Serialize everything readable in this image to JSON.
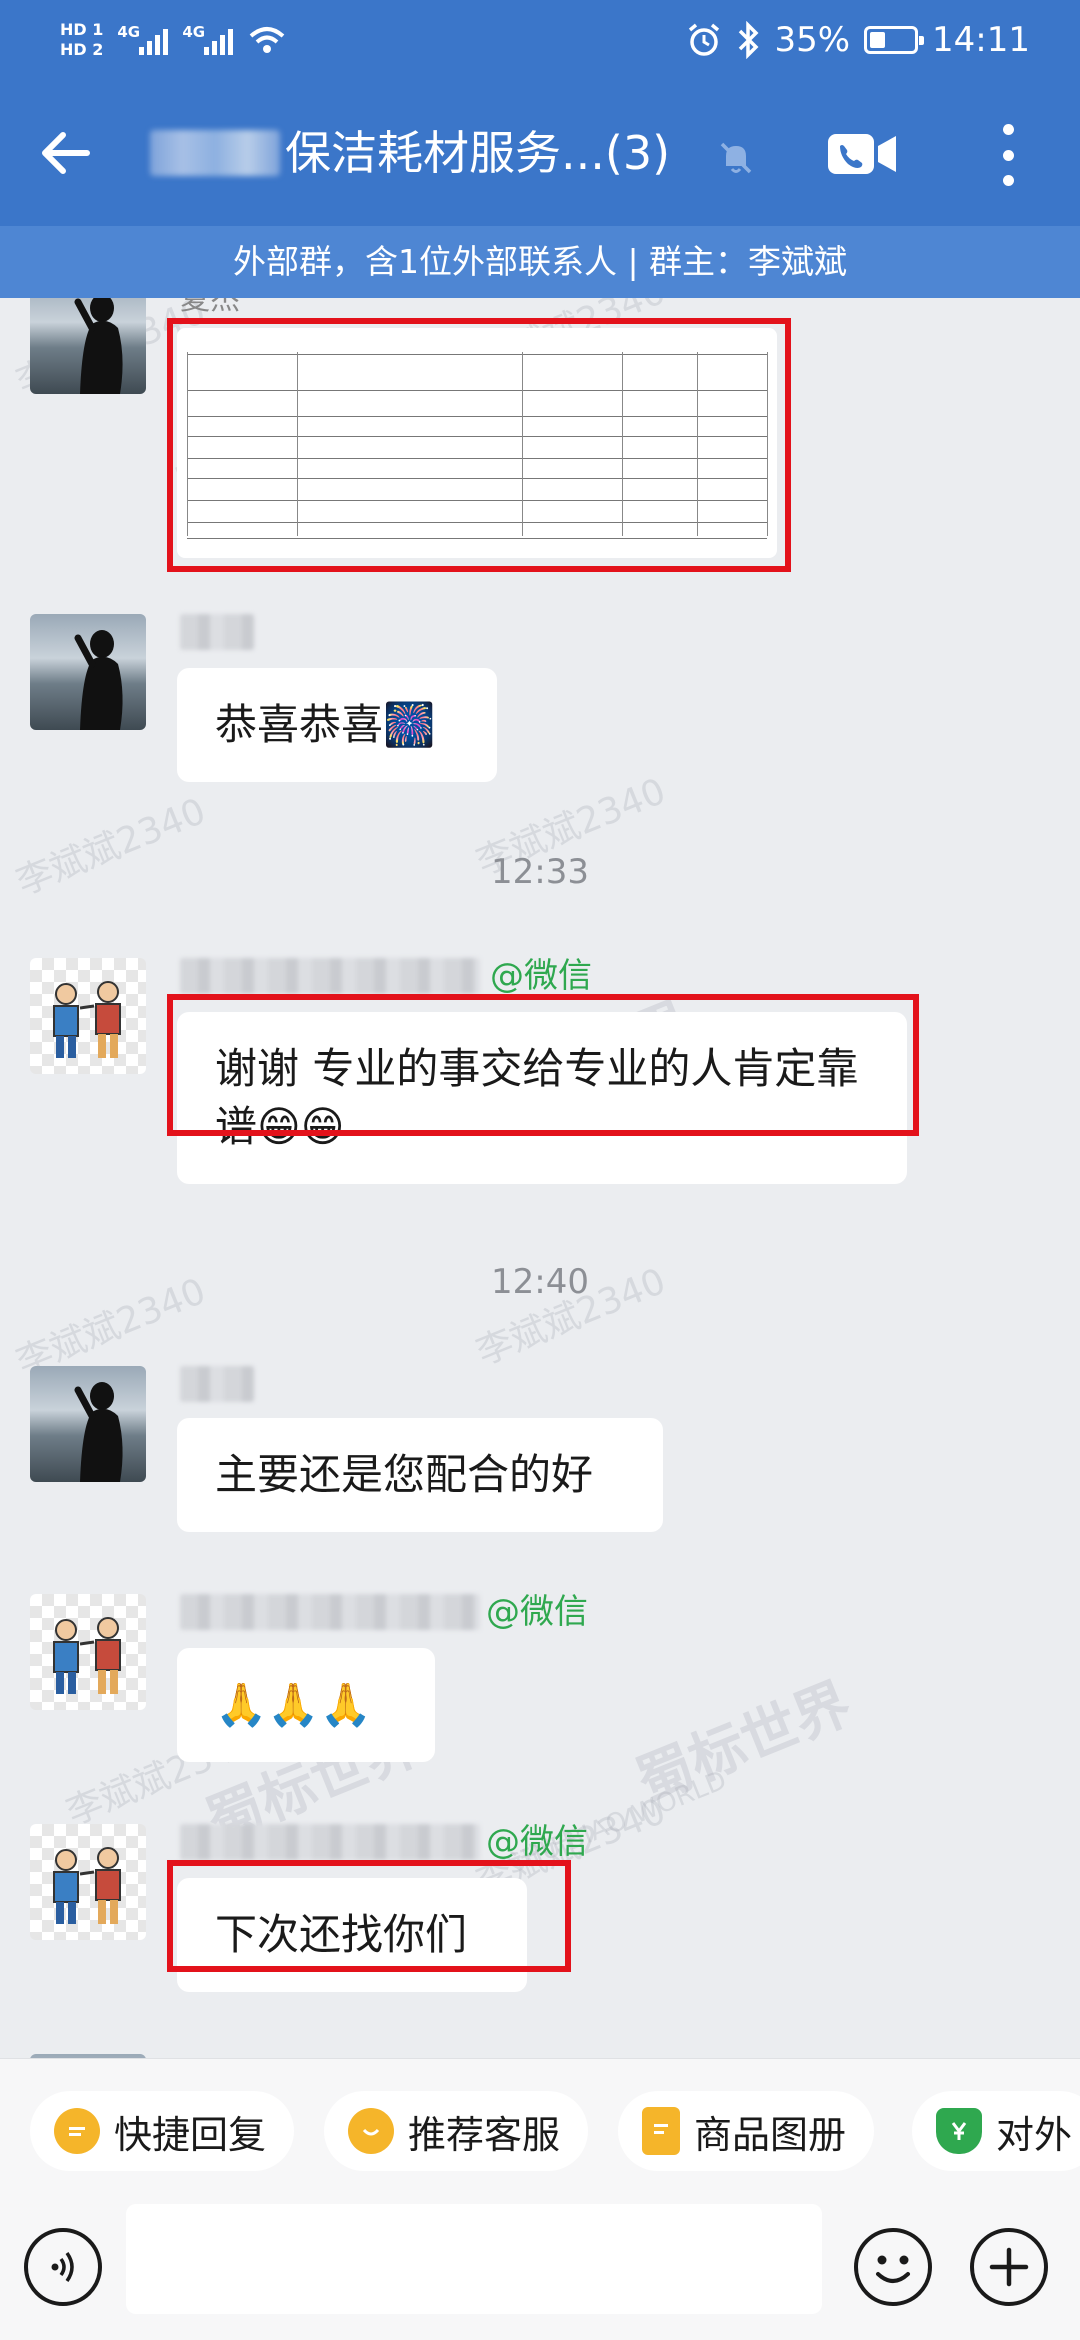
{
  "status_bar": {
    "hd1": "HD 1",
    "hd2": "HD 2",
    "net1": "4G",
    "net2": "4G",
    "battery_percent": "35%",
    "battery_level": 0.35,
    "time": "14:11"
  },
  "header": {
    "title": "保洁耗材服务...(3)",
    "subtitle": "外部群，含1位外部联系人 | 群主：李斌斌"
  },
  "watermark": {
    "text": "李斌斌2340",
    "logo_cn": "蜀标世界",
    "logo_en": "SHU BIAO WORLD"
  },
  "messages": [
    {
      "sender": "夏杰",
      "type": "file-image"
    },
    {
      "sender": "",
      "text": "恭喜恭喜🎆"
    },
    {
      "time": "12:33"
    },
    {
      "sender_tag": "@微信",
      "text": "谢谢  专业的事交给专业的人肯定靠谱😁😁"
    },
    {
      "time": "12:40"
    },
    {
      "sender": "",
      "text": "主要还是您配合的好"
    },
    {
      "sender_tag": "@微信",
      "text": "🙏🙏🙏"
    },
    {
      "sender_tag": "@微信",
      "text": "下次还找你们"
    }
  ],
  "quick_actions": [
    {
      "label": "快捷回复",
      "icon": "quick-reply-icon",
      "color": "#f5b52a"
    },
    {
      "label": "推荐客服",
      "icon": "recommend-service-icon",
      "color": "#f5b52a"
    },
    {
      "label": "商品图册",
      "icon": "product-catalog-icon",
      "color": "#f5b52a"
    },
    {
      "label": "对外",
      "icon": "payment-icon",
      "color": "#2fa84f"
    }
  ],
  "input": {
    "placeholder": ""
  },
  "colors": {
    "header": "#3b76c9",
    "highlight": "#e3121b",
    "wechat_tag": "#2fa84f"
  }
}
